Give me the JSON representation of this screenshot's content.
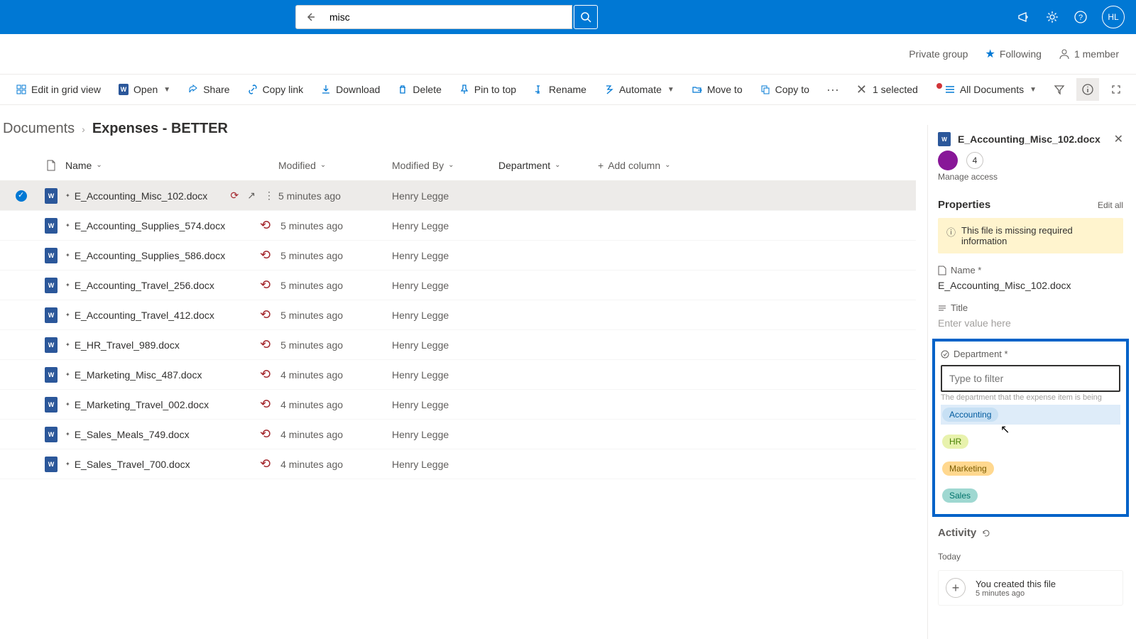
{
  "search": {
    "value": "misc"
  },
  "avatar": "HL",
  "group": {
    "privacy": "Private group",
    "following": "Following",
    "members": "1 member"
  },
  "commands": {
    "edit_grid": "Edit in grid view",
    "open": "Open",
    "share": "Share",
    "copy_link": "Copy link",
    "download": "Download",
    "delete": "Delete",
    "pin": "Pin to top",
    "rename": "Rename",
    "automate": "Automate",
    "move": "Move to",
    "copy": "Copy to"
  },
  "selection": {
    "count": "1 selected",
    "view": "All Documents"
  },
  "breadcrumb": {
    "root": "Documents",
    "current": "Expenses - BETTER"
  },
  "columns": {
    "name": "Name",
    "modified": "Modified",
    "modified_by": "Modified By",
    "department": "Department",
    "add": "Add column"
  },
  "rows": [
    {
      "name": "E_Accounting_Misc_102.docx",
      "modified": "5 minutes ago",
      "by": "Henry Legge",
      "selected": true
    },
    {
      "name": "E_Accounting_Supplies_574.docx",
      "modified": "5 minutes ago",
      "by": "Henry Legge",
      "selected": false
    },
    {
      "name": "E_Accounting_Supplies_586.docx",
      "modified": "5 minutes ago",
      "by": "Henry Legge",
      "selected": false
    },
    {
      "name": "E_Accounting_Travel_256.docx",
      "modified": "5 minutes ago",
      "by": "Henry Legge",
      "selected": false
    },
    {
      "name": "E_Accounting_Travel_412.docx",
      "modified": "5 minutes ago",
      "by": "Henry Legge",
      "selected": false
    },
    {
      "name": "E_HR_Travel_989.docx",
      "modified": "5 minutes ago",
      "by": "Henry Legge",
      "selected": false
    },
    {
      "name": "E_Marketing_Misc_487.docx",
      "modified": "4 minutes ago",
      "by": "Henry Legge",
      "selected": false
    },
    {
      "name": "E_Marketing_Travel_002.docx",
      "modified": "4 minutes ago",
      "by": "Henry Legge",
      "selected": false
    },
    {
      "name": "E_Sales_Meals_749.docx",
      "modified": "4 minutes ago",
      "by": "Henry Legge",
      "selected": false
    },
    {
      "name": "E_Sales_Travel_700.docx",
      "modified": "4 minutes ago",
      "by": "Henry Legge",
      "selected": false
    }
  ],
  "details": {
    "title": "E_Accounting_Misc_102.docx",
    "share_count": "4",
    "manage": "Manage access",
    "props_h": "Properties",
    "edit_all": "Edit all",
    "warning": "This file is missing required information",
    "name_label": "Name *",
    "name_value": "E_Accounting_Misc_102.docx",
    "title_label": "Title",
    "title_placeholder": "Enter value here",
    "dept_label": "Department *",
    "filter_placeholder": "Type to filter",
    "help": "The department that the expense item is being",
    "options": [
      {
        "label": "Accounting",
        "cls": "pill-acc",
        "hl": true
      },
      {
        "label": "HR",
        "cls": "pill-hr",
        "hl": false
      },
      {
        "label": "Marketing",
        "cls": "pill-mkt",
        "hl": false
      },
      {
        "label": "Sales",
        "cls": "pill-sales",
        "hl": false
      }
    ],
    "activity_h": "Activity",
    "today": "Today",
    "activity_text": "You created this file",
    "activity_time": "5 minutes ago"
  }
}
